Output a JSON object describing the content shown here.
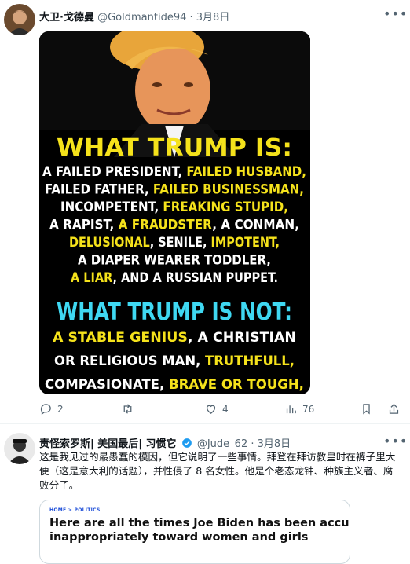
{
  "tweet1": {
    "display_name": "大卫·戈德曼",
    "handle": "@Goldmantide94",
    "separator": "·",
    "date": "3月8日",
    "more_icon": "more-icon",
    "image": {
      "heading_is": "WHAT TRUMP IS:",
      "lines_is": [
        [
          [
            "A FAILED PRESIDENT, ",
            "w"
          ],
          [
            "FAILED HUSBAND,",
            "y"
          ]
        ],
        [
          [
            "FAILED FATHER, ",
            "w"
          ],
          [
            "FAILED BUSINESSMAN,",
            "y"
          ]
        ],
        [
          [
            "INCOMPETENT, ",
            "w"
          ],
          [
            "FREAKING STUPID,",
            "y"
          ]
        ],
        [
          [
            "A RAPIST, ",
            "w"
          ],
          [
            "A FRAUDSTER",
            "y"
          ],
          [
            ", A CONMAN,",
            "w"
          ]
        ],
        [
          [
            "DELUSIONAL",
            "y"
          ],
          [
            ", SENILE, ",
            "w"
          ],
          [
            "IMPOTENT,",
            "y"
          ]
        ],
        [
          [
            "A DIAPER WEARER TODDLER,",
            "w"
          ]
        ],
        [
          [
            "A LIAR",
            "y"
          ],
          [
            ", AND A RUSSIAN PUPPET.",
            "w"
          ]
        ]
      ],
      "heading_not": "WHAT TRUMP IS NOT:",
      "lines_not": [
        [
          [
            "A STABLE GENIUS",
            "y"
          ],
          [
            ", A CHRISTIAN",
            "w"
          ]
        ],
        [
          [
            "OR RELIGIOUS MAN, ",
            "w"
          ],
          [
            "TRUTHFULL,",
            "y"
          ]
        ],
        [
          [
            "COMPASIONATE, ",
            "w"
          ],
          [
            "BRAVE OR TOUGH,",
            "y"
          ]
        ]
      ],
      "colors": {
        "white": "#ffffff",
        "yellow": "#f5e21b",
        "cyan": "#3fd8f2",
        "background": "#000000"
      }
    },
    "actions": {
      "reply_count": "2",
      "retweet_count": "",
      "like_count": "4",
      "views_count": "76"
    }
  },
  "tweet2": {
    "display_name": "责怪索罗斯| 美国最后| 习惯它",
    "handle": "@Jude_62",
    "separator": "·",
    "date": "3月8日",
    "text": "这是我见过的最愚蠢的模因，但它说明了一些事情。拜登在拜访教皇时在裤子里大便（这是意大利的话题），并性侵了 8 名女性。他是个老态龙钟、种族主义者、腐败分子。",
    "card": {
      "tag": "HOME > POLITICS",
      "headline_line1": "Here are all the times Joe Biden has been accused of a",
      "headline_line2": "inappropriately toward women and girls"
    }
  },
  "colors": {
    "accent": "#1d9bf0",
    "muted": "#536471"
  }
}
